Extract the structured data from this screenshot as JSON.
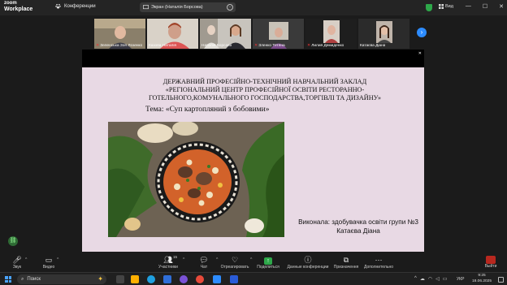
{
  "app": {
    "logo_line1": "zoom",
    "logo_line2": "Workplace"
  },
  "titlebar": {
    "conference_tab": "Конференции",
    "screen_title": "Экран (Наталія Борсова)",
    "view_label": "Вид",
    "win_minimize": "—",
    "win_maximize": "☐",
    "win_close": "✕"
  },
  "participants": [
    {
      "name": "Зеленська Зоя Лозенко",
      "muted": true,
      "active": false
    },
    {
      "name": "Казова Наталія",
      "muted": false,
      "active": false
    },
    {
      "name": "Наталія Борсова",
      "muted": false,
      "active": true
    },
    {
      "name": "Зленко Тетяна",
      "muted": true,
      "active": false
    },
    {
      "name": "Лилия Демиденко",
      "muted": true,
      "active": false
    },
    {
      "name": "Катаєва Діана",
      "muted": false,
      "active": false
    }
  ],
  "slide": {
    "title_line1": "ДЕРЖАВНИЙ ПРОФЕСІЙНО-ТЕХНІЧНИЙ НАВЧАЛЬНИЙ ЗАКЛАД",
    "title_line2": "«РЕГІОНАЛЬНИЙ ЦЕНТР ПРОФЕСІЙНОЇ ОСВІТИ РЕСТОРАННО-",
    "title_line3": "ГОТЕЛЬНОГО,КОМУНАЛЬНОГО ГОСПОДАРСТВА,ТОРГІВЛІ ТА ДИЗАЙНУ»",
    "topic": "Тема: «Суп картопляний з бобовими»",
    "author_line1": "Виконала: здобувачка освіти групи №3",
    "author_line2": "Катаєва Діана"
  },
  "toolbar": {
    "audio": "Звук",
    "video": "Видео",
    "participants": "Участники",
    "participants_count": "15",
    "chat": "Чат",
    "react": "Отреагировать",
    "share": "Поделиться",
    "info": "Данные конференции",
    "captions": "Призначення",
    "more": "Дополнительно",
    "leave": "Выйти"
  },
  "taskbar": {
    "search_placeholder": "Поиск",
    "tray_arrow": "^",
    "language": "УКР",
    "time": "9:25",
    "date": "18.06.2025"
  },
  "colors": {
    "accent": "#2d8cff",
    "active_speaker": "#3ec45a",
    "slide_bg": "#e8d9e4",
    "leave_red": "#b8281f"
  }
}
